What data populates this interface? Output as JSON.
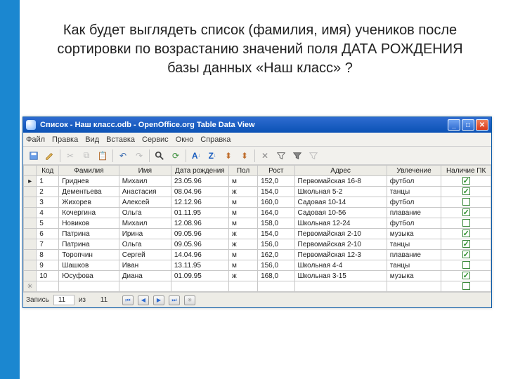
{
  "question": "Как будет выглядеть список (фамилия, имя) учеников после сортировки по возрастанию значений поля ДАТА РОЖДЕНИЯ базы данных «Наш класс» ?",
  "window": {
    "title": "Список - Наш класс.odb - OpenOffice.org Table Data View"
  },
  "menu": {
    "file": "Файл",
    "edit": "Правка",
    "view": "Вид",
    "insert": "Вставка",
    "tools": "Сервис",
    "window": "Окно",
    "help": "Справка"
  },
  "headers": {
    "kod": "Код",
    "fam": "Фамилия",
    "nam": "Имя",
    "dat": "Дата рождения",
    "pol": "Пол",
    "rost": "Рост",
    "adr": "Адрес",
    "uvl": "Увлечение",
    "pk": "Наличие ПК"
  },
  "rows": [
    {
      "kod": "1",
      "fam": "Гриднев",
      "nam": "Михаил",
      "dat": "23.05.96",
      "pol": "м",
      "rost": "152,0",
      "adr": "Первомайская 16-8",
      "uvl": "футбол",
      "pk": true
    },
    {
      "kod": "2",
      "fam": "Дементьева",
      "nam": "Анастасия",
      "dat": "08.04.96",
      "pol": "ж",
      "rost": "154,0",
      "adr": "Школьная 5-2",
      "uvl": "танцы",
      "pk": true
    },
    {
      "kod": "3",
      "fam": "Жихорев",
      "nam": "Алексей",
      "dat": "12.12.96",
      "pol": "м",
      "rost": "160,0",
      "adr": "Садовая 10-14",
      "uvl": "футбол",
      "pk": false
    },
    {
      "kod": "4",
      "fam": "Кочергина",
      "nam": "Ольга",
      "dat": "01.11.95",
      "pol": "м",
      "rost": "164,0",
      "adr": "Садовая 10-56",
      "uvl": "плавание",
      "pk": true
    },
    {
      "kod": "5",
      "fam": "Новиков",
      "nam": "Михаил",
      "dat": "12.08.96",
      "pol": "м",
      "rost": "158,0",
      "adr": "Школьная 12-24",
      "uvl": "футбол",
      "pk": false
    },
    {
      "kod": "6",
      "fam": "Патрина",
      "nam": "Ирина",
      "dat": "09.05.96",
      "pol": "ж",
      "rost": "154,0",
      "adr": "Первомайская 2-10",
      "uvl": "музыка",
      "pk": true
    },
    {
      "kod": "7",
      "fam": "Патрина",
      "nam": "Ольга",
      "dat": "09.05.96",
      "pol": "ж",
      "rost": "156,0",
      "adr": "Первомайская 2-10",
      "uvl": "танцы",
      "pk": true
    },
    {
      "kod": "8",
      "fam": "Торопчин",
      "nam": "Сергей",
      "dat": "14.04.96",
      "pol": "м",
      "rost": "162,0",
      "adr": "Первомайская 12-3",
      "uvl": "плавание",
      "pk": true
    },
    {
      "kod": "9",
      "fam": "Шашков",
      "nam": "Иван",
      "dat": "13.11.95",
      "pol": "м",
      "rost": "156,0",
      "adr": "Школьная 4-4",
      "uvl": "танцы",
      "pk": false
    },
    {
      "kod": "10",
      "fam": "Юсуфова",
      "nam": "Диана",
      "dat": "01.09.95",
      "pol": "ж",
      "rost": "168,0",
      "adr": "Школьная 3-15",
      "uvl": "музыка",
      "pk": true
    }
  ],
  "status": {
    "label_record": "Запись",
    "current": "11",
    "of": "из",
    "total": "11"
  }
}
